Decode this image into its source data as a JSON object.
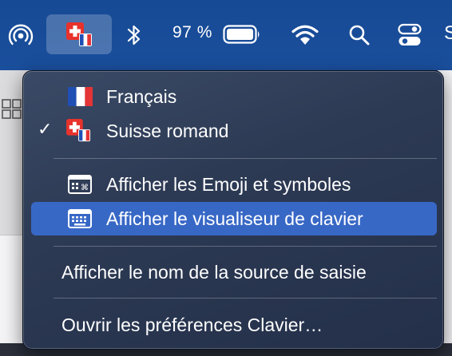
{
  "menubar": {
    "battery_percent": "97 %",
    "battery_level": 0.97,
    "icons": [
      "airdrop-icon",
      "input-source-swiss-icon",
      "bluetooth-icon",
      "battery-icon",
      "wifi-icon",
      "search-icon",
      "control-center-icon"
    ]
  },
  "menu": {
    "items": [
      {
        "label": "Français",
        "icon": "flag-france-icon"
      },
      {
        "label": "Suisse romand",
        "icon": "flag-swiss-icon",
        "checked": true
      },
      {
        "label": "Afficher les Emoji et symboles",
        "icon": "emoji-viewer-icon"
      },
      {
        "label": "Afficher le visualiseur de clavier",
        "icon": "keyboard-viewer-icon",
        "highlighted": true
      },
      {
        "label": "Afficher le nom de la source de saisie"
      },
      {
        "label": "Ouvrir les préférences Clavier…"
      }
    ],
    "checkmark": "✓"
  },
  "colors": {
    "menubar": "#1a4f9d",
    "highlight": "#3868c6",
    "menu_bg": "#2d3a54"
  }
}
